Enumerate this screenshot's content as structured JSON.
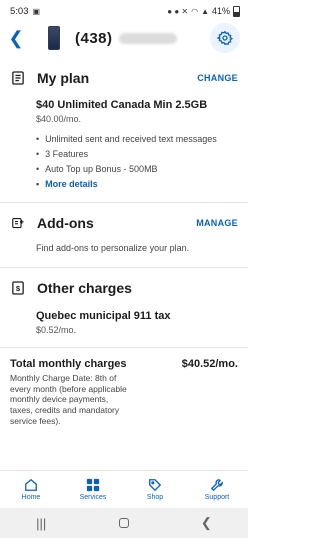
{
  "status_bar": {
    "time": "5:03",
    "battery": "41%",
    "battery_level": 0.41
  },
  "header": {
    "phone_prefix": "(438)"
  },
  "my_plan": {
    "title": "My plan",
    "action": "CHANGE",
    "plan_name": "$40 Unlimited Canada Min 2.5GB",
    "plan_price": "$40.00/mo.",
    "features": [
      "Unlimited sent and received text messages",
      "3 Features",
      "Auto Top up Bonus - 500MB"
    ],
    "more_link": "More details"
  },
  "add_ons": {
    "title": "Add-ons",
    "action": "MANAGE",
    "description": "Find add-ons to personalize your plan."
  },
  "other_charges": {
    "title": "Other charges",
    "charge_name": "Quebec municipal 911 tax",
    "charge_price": "$0.52/mo."
  },
  "total": {
    "label": "Total monthly charges",
    "amount": "$40.52/mo.",
    "note": "Monthly Charge Date: 8th of every month (before applicable monthly device payments, taxes, credits and mandatory service fees)."
  },
  "bottom_nav": {
    "items": [
      "Home",
      "Services",
      "Shop",
      "Support"
    ],
    "active": "Services"
  },
  "colors": {
    "accent": "#0a60c2"
  }
}
